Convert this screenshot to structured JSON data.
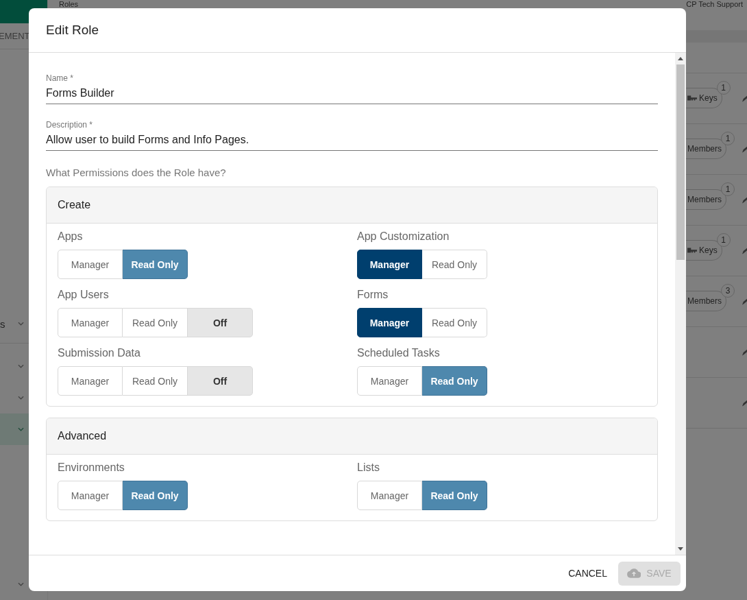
{
  "background": {
    "title": "Roles",
    "account": "CP Tech Support",
    "tab": "EMENT",
    "sidebar_items": [
      {
        "label": "s",
        "selected": false
      },
      {
        "selected": false
      },
      {
        "selected": false
      },
      {
        "selected": true
      },
      {
        "selected": false
      }
    ],
    "rows": [
      {
        "kind": "keys",
        "chip": "Keys",
        "count": "1"
      },
      {
        "kind": "members",
        "chip": "Members",
        "count": "1"
      },
      {
        "kind": "members",
        "chip": "Members",
        "count": "1"
      },
      {
        "kind": "keys",
        "chip": "Keys",
        "count": "1"
      },
      {
        "kind": "members",
        "chip": "Members",
        "count": "3"
      },
      {
        "kind": "empty"
      },
      {
        "kind": "empty"
      }
    ]
  },
  "dialog": {
    "title": "Edit Role",
    "fields": [
      {
        "label": "Name *",
        "value": "Forms Builder"
      },
      {
        "label": "Description *",
        "value": "Allow user to build Forms and Info Pages."
      }
    ],
    "question": "What Permissions does the Role have?",
    "sections": [
      {
        "title": "Create",
        "permissions": [
          {
            "label": "Apps",
            "options": [
              {
                "kind": "manager",
                "label": "Manager",
                "selected": false
              },
              {
                "kind": "read_only",
                "label": "Read Only",
                "selected": true
              }
            ]
          },
          {
            "label": "App Customization",
            "options": [
              {
                "kind": "manager",
                "label": "Manager",
                "selected": true
              },
              {
                "kind": "read_only",
                "label": "Read Only",
                "selected": false
              }
            ]
          },
          {
            "label": "App Users",
            "options": [
              {
                "kind": "manager",
                "label": "Manager",
                "selected": false
              },
              {
                "kind": "read_only",
                "label": "Read Only",
                "selected": false
              },
              {
                "kind": "off",
                "label": "Off",
                "selected": true
              }
            ]
          },
          {
            "label": "Forms",
            "options": [
              {
                "kind": "manager",
                "label": "Manager",
                "selected": true
              },
              {
                "kind": "read_only",
                "label": "Read Only",
                "selected": false
              }
            ]
          },
          {
            "label": "Submission Data",
            "options": [
              {
                "kind": "manager",
                "label": "Manager",
                "selected": false
              },
              {
                "kind": "read_only",
                "label": "Read Only",
                "selected": false
              },
              {
                "kind": "off",
                "label": "Off",
                "selected": true
              }
            ]
          },
          {
            "label": "Scheduled Tasks",
            "options": [
              {
                "kind": "manager",
                "label": "Manager",
                "selected": false
              },
              {
                "kind": "read_only",
                "label": "Read Only",
                "selected": true
              }
            ]
          }
        ]
      },
      {
        "title": "Advanced",
        "permissions": [
          {
            "label": "Environments",
            "options": [
              {
                "kind": "manager",
                "label": "Manager",
                "selected": false
              },
              {
                "kind": "read_only",
                "label": "Read Only",
                "selected": true
              }
            ]
          },
          {
            "label": "Lists",
            "options": [
              {
                "kind": "manager",
                "label": "Manager",
                "selected": false
              },
              {
                "kind": "read_only",
                "label": "Read Only",
                "selected": true
              }
            ]
          }
        ]
      }
    ],
    "buttons": [
      {
        "kind": "cancel",
        "label": "CANCEL",
        "disabled": false
      },
      {
        "kind": "save",
        "label": "SAVE",
        "disabled": true
      }
    ]
  }
}
